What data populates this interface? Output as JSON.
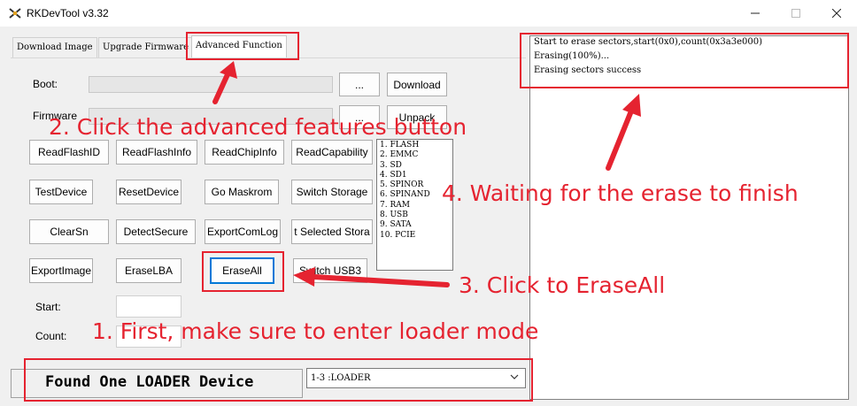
{
  "window": {
    "title": "RKDevTool v3.32",
    "app_icon": "rk-tool-icon",
    "minimize_icon": "minimize-icon",
    "maximize_icon": "maximize-icon",
    "close_icon": "close-icon"
  },
  "tabs": [
    {
      "label": "Download Image"
    },
    {
      "label": "Upgrade Firmware"
    },
    {
      "label": "Advanced Function",
      "active": true
    }
  ],
  "boot": {
    "label": "Boot:",
    "browse_label": "...",
    "download_label": "Download"
  },
  "firmware": {
    "label": "Firmware",
    "browse_label": "...",
    "unpack_label": "Unpack"
  },
  "buttons": {
    "read_flash_id": "ReadFlashID",
    "read_flash_info": "ReadFlashInfo",
    "read_chip_info": "ReadChipInfo",
    "read_capability": "ReadCapability",
    "test_device": "TestDevice",
    "reset_device": "ResetDevice",
    "go_maskrom": "Go Maskrom",
    "switch_storage": "Switch Storage",
    "clear_sn": "ClearSn",
    "detect_secure": "DetectSecure",
    "export_com_log": "ExportComLog",
    "export_selected_storage": "t Selected Stora",
    "export_image": "ExportImage",
    "erase_lba": "EraseLBA",
    "erase_all": "EraseAll",
    "switch_usb3": "Switch USB3"
  },
  "storage_list": [
    "1.  FLASH",
    "2.  EMMC",
    "3.  SD",
    "4.  SD1",
    "5.  SPINOR",
    "6.  SPINAND",
    "7.  RAM",
    "8.  USB",
    "9.  SATA",
    "10.  PCIE"
  ],
  "start": {
    "label": "Start:",
    "value": ""
  },
  "count": {
    "label": "Count:",
    "value": ""
  },
  "status": {
    "text": "Found One LOADER Device"
  },
  "device_select": {
    "selected": "1-3 :LOADER"
  },
  "log": {
    "lines": [
      "Start to erase sectors,start(0x0),count(0x3a3e000)",
      "Erasing(100%)...",
      "Erasing sectors success"
    ]
  },
  "annotations": {
    "step1": "1. First, make sure to enter loader mode",
    "step2": "2. Click the advanced features button",
    "step3": "3. Click to EraseAll",
    "step4": "4. Waiting for the erase to finish",
    "color": "#e52330"
  }
}
